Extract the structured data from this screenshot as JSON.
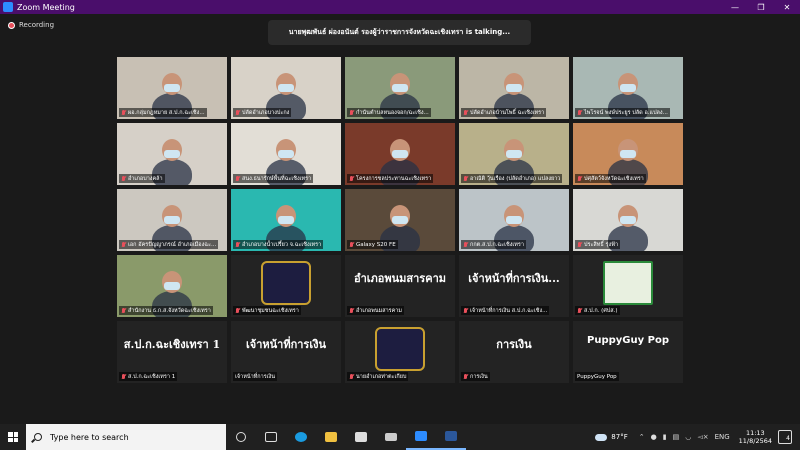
{
  "window": {
    "title": "Zoom Meeting"
  },
  "recording": "Recording",
  "talking": "นายพุฒพันธ์ ผ่องอนันต์ รองผู้ว่าราชการจังหวัดฉะเชิงเทรา is talking...",
  "tiles": [
    {
      "name": "ผอ.กลุ่มกฎหมาย ส.ป.ก.ฉะเชิง...",
      "muted": true,
      "bg": "#c8c0b4"
    },
    {
      "name": "ปลัดอำเภอบางปะกง",
      "muted": true,
      "bg": "#d8d2c8"
    },
    {
      "name": "กำนันตำบลหนองจอก/ฉะเชิง...",
      "muted": true,
      "bg": "#8a9a7a"
    },
    {
      "name": "ปลัดอำเภอบ้านโพธิ์ ฉะเชิงเทรา",
      "muted": true,
      "bg": "#bcb6a6"
    },
    {
      "name": "ไพโรจน์ พงษ์ประยูร ปลัด อ.แปลง...",
      "muted": true,
      "bg": "#a9b8b4"
    },
    {
      "name": "อำเภอบางคล้า",
      "muted": true,
      "bg": "#d6d0c8"
    },
    {
      "name": "สนง.ธนารักษ์พื้นที่ฉะเชิงเทรา",
      "muted": true,
      "bg": "#e2ded6"
    },
    {
      "name": "โครงการชลประทานฉะเชิงเทรา",
      "muted": true,
      "bg": "#7a3a2a"
    },
    {
      "name": "อาณัติ วุ้นเรือง (ปลัดอำเภอ) แปลงยาว",
      "muted": true,
      "bg": "#b8b08a"
    },
    {
      "name": "ปศุสัตว์จังหวัดฉะเชิงเทรา",
      "muted": true,
      "bg": "#c88a5a"
    },
    {
      "name": "เอก อัครปัญญาภรณ์ อำเภอเมืองฉะ...",
      "muted": true,
      "bg": "#ccc8c0"
    },
    {
      "name": "อำเภอบางน้ำเปรี้ยว จ.ฉะเชิงเทรา",
      "muted": true,
      "bg": "#2ab8b0"
    },
    {
      "name": "Galaxy S20 FE",
      "muted": true,
      "bg": "#5a4a3a"
    },
    {
      "name": "กกต.ส.ป.ก.ฉะเชิงเทรา",
      "muted": true,
      "bg": "#bcc4c8"
    },
    {
      "name": "ประสิทธิ์ รุ่งฟ้า",
      "muted": true,
      "bg": "#d8d8d4"
    },
    {
      "name": "สำนักงาน ธ.ก.ส.จังหวัดฉะเชิงเทรา",
      "muted": true,
      "bg": "#8a9a6a"
    },
    {
      "name": "พัฒนาชุมชนฉะเชิงเทรา",
      "muted": true,
      "bg": "#232323"
    },
    {
      "name": "อำเภอพนมสารคาม",
      "muted": true,
      "bg": "#232323",
      "big": "อำเภอพนมสารคาม"
    },
    {
      "name": "เจ้าหน้าที่การเงิน ส.ป.ก.ฉะเชิง...",
      "muted": true,
      "bg": "#232323",
      "big": "เจ้าหน้าที่การเงิน..."
    },
    {
      "name": "ส.ป.ก. (ศปส.)",
      "muted": true,
      "bg": "#232323"
    },
    {
      "name": "ส.ป.ก.ฉะเชิงเทรา 1",
      "muted": true,
      "bg": "#232323",
      "big": "ส.ป.ก.ฉะเชิงเทรา 1"
    },
    {
      "name": "เจ้าหน้าที่การเงิน",
      "muted": false,
      "bg": "#232323",
      "big": "เจ้าหน้าที่การเงิน"
    },
    {
      "name": "นายอำเภอท่าตะเกียบ",
      "muted": true,
      "bg": "#232323"
    },
    {
      "name": "การเงิน",
      "muted": true,
      "bg": "#232323",
      "big": "การเงิน"
    },
    {
      "name": "PuppyGuy Pop",
      "muted": false,
      "bg": "#232323",
      "big": "PuppyGuy Pop"
    }
  ],
  "taskbar": {
    "search_placeholder": "Type here to search",
    "weather": "87°F",
    "lang": "ENG",
    "time": "11:13",
    "date": "11/8/2564",
    "notifications": "4"
  }
}
